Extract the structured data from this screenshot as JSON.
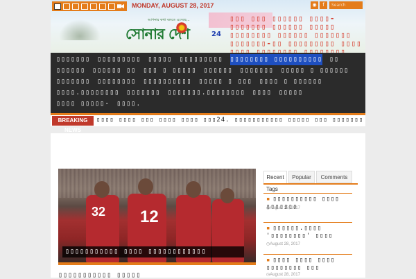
{
  "topbar": {
    "home_icon": "home-icon",
    "menu_glyphs": "▯▯▯▯▯▯",
    "camera_icon": "video-camera-icon",
    "date": "MONDAY, AUGUST 28, 2017",
    "rss_icon": "rss-icon",
    "facebook_icon": "facebook-icon",
    "search_placeholder": "Search",
    "accent": "#e47c1a"
  },
  "logo": {
    "tagline": "আপনার কথা বলতে এসেছে...",
    "name": "সোনার দেশ",
    "suffix": "24"
  },
  "header_headline": [
    "▯▯▯ ▯▯▯ ▯▯▯▯▯▯ ▯▯▯▯-",
    "▯▯▯▯▯▯▯ ▯▯▯▯▯▯ ▯▯▯▯▯",
    "▯▯▯▯▯▯▯▯ ▯▯▯▯▯▯ ▯▯▯▯▯▯▯",
    "▯▯▯▯▯▯▯-▯▯ ▯▯▯▯▯▯▯▯▯ ▯▯▯▯-",
    "▯▯▯▯ ▯▯▯▯▯▯▯▯ ▯▯▯▯▯▯▯▯"
  ],
  "nav": {
    "items": [
      "▯▯▯▯▯▯▯",
      "▯▯▯▯▯▯▯▯▯",
      "▯▯▯▯▯",
      "▯▯▯▯▯▯▯▯▯",
      "▯▯▯▯▯▯▯▯ ▯▯▯▯▯▯▯▯▯▯",
      "▯▯",
      "▯▯▯▯▯▯",
      "▯▯▯▯▯▯ ▯▯",
      "▯▯▯ ▯ ▯▯▯▯▯",
      "▯▯▯▯▯▯",
      "▯▯▯▯▯▯▯",
      "▯▯▯▯▯ ▯ ▯▯▯▯▯▯",
      "▯▯▯▯▯▯▯",
      "▯▯▯▯▯▯▯▯",
      "▯▯▯▯▯▯▯▯▯▯",
      "▯▯▯▯▯ ▯ ▯▯▯",
      "▯▯▯▯ ▯ ▯▯▯▯▯▯",
      "▯▯▯▯.▯▯▯▯▯▯▯▯",
      "▯▯▯▯▯▯▯",
      "▯▯▯▯▯▯▯.▯▯▯▯▯▯▯▯",
      "▯▯▯▯",
      "▯▯▯▯▯",
      "▯▯▯▯ ▯▯▯▯▯-",
      "▯▯▯▯."
    ],
    "active_index": 4
  },
  "breaking": {
    "label": "BREAKING NEWS",
    "text": "▯▯▯▯ ▯▯▯▯ ▯▯▯ ▯▯▯▯ ▯▯▯▯ ▯▯▯24. ▯▯▯▯▯▯▯▯▯▯▯ ▯▯▯▯▯ ▯▯▯ ▯▯▯▯▯▯▯▯▯"
  },
  "hero": {
    "caption": "▯▯▯▯▯▯▯▯▯▯▯ ▯▯▯▯ ▯▯▯▯▯▯▯▯▯▯▯▯",
    "jersey_numbers": [
      "32",
      "12"
    ]
  },
  "below_title": "▯▯▯▯▯▯▯▯▯▯▯ ▯▯▯▯▯",
  "sidebar": {
    "tabs": [
      "Recent",
      "Popular",
      "Comments"
    ],
    "tags_label": "Tags",
    "items": [
      {
        "title": "▯▯▯▯▯▯▯▯▯▯ ▯▯▯▯ ▯▯▯▯▯▯▯",
        "date": "August 28, 2017"
      },
      {
        "title": "▯▯▯▯▯▯.▯▯▯▯ '▯▯▯▯▯▯▯▯' ▯▯▯▯",
        "date": "August 28, 2017"
      },
      {
        "title": "▯▯▯▯ ▯▯▯▯ ▯▯▯▯ ▯▯▯▯▯▯▯▯ ▯▯▯",
        "date": "August 28, 2017"
      }
    ],
    "clock_icon": "clock-icon"
  }
}
